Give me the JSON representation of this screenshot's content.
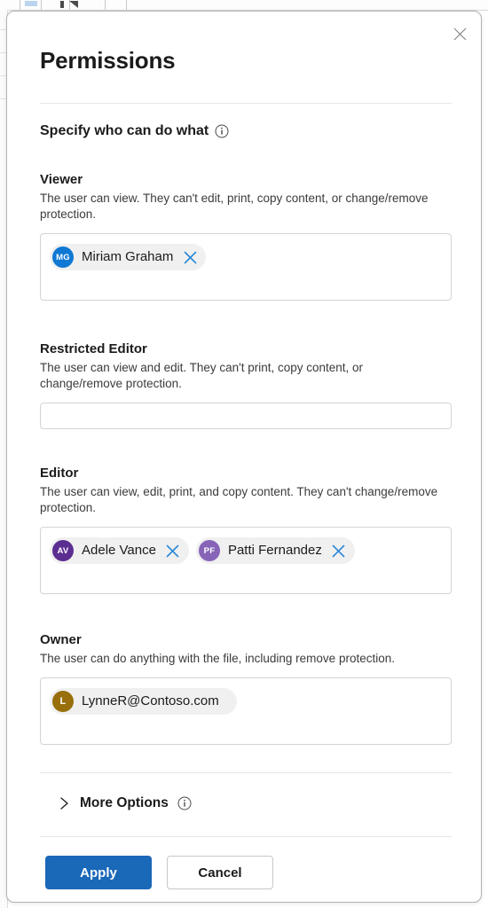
{
  "background": {
    "app_name": "spreadsheet-backdrop"
  },
  "dialog": {
    "title": "Permissions",
    "close_icon": "close-icon",
    "specify_label": "Specify who can do what",
    "specify_info_icon": "info-icon",
    "sections": [
      {
        "key": "viewer",
        "title": "Viewer",
        "description": "The user can view. They can't edit, print, copy content, or change/remove protection.",
        "people": [
          {
            "initials": "MG",
            "name": "Miriam Graham",
            "color": "#0f78d4",
            "removable": true,
            "remove_icon": "remove-icon"
          }
        ]
      },
      {
        "key": "restricted_editor",
        "title": "Restricted Editor",
        "description": "The user can view and edit. They can't print, copy content, or change/remove protection.",
        "people": [],
        "placeholder": ""
      },
      {
        "key": "editor",
        "title": "Editor",
        "description": "The user can view, edit, print, and copy content. They can't change/remove protection.",
        "people": [
          {
            "initials": "AV",
            "name": "Adele Vance",
            "color": "#5c2e91",
            "removable": true,
            "remove_icon": "remove-icon"
          },
          {
            "initials": "PF",
            "name": "Patti Fernandez",
            "color": "#8764b8",
            "removable": true,
            "remove_icon": "remove-icon"
          }
        ]
      },
      {
        "key": "owner",
        "title": "Owner",
        "description": "The user can do anything with the file, including remove protection.",
        "people": [
          {
            "initials": "L",
            "name": "LynneR@Contoso.com",
            "color": "#986f0b",
            "removable": false,
            "remove_icon": ""
          }
        ]
      }
    ],
    "more_options": {
      "label": "More Options",
      "chevron_icon": "chevron-right-icon",
      "info_icon": "info-icon",
      "expanded": false
    },
    "footer": {
      "apply_label": "Apply",
      "cancel_label": "Cancel"
    }
  },
  "colors": {
    "accent": "#1a68b8",
    "remove_icon": "#2b88d8",
    "pill_background": "#f0f0f0",
    "field_border": "#d4d4d4",
    "divider": "#e6e6e6",
    "text_primary": "#1b1b1b",
    "text_secondary": "#3b3b3b"
  }
}
